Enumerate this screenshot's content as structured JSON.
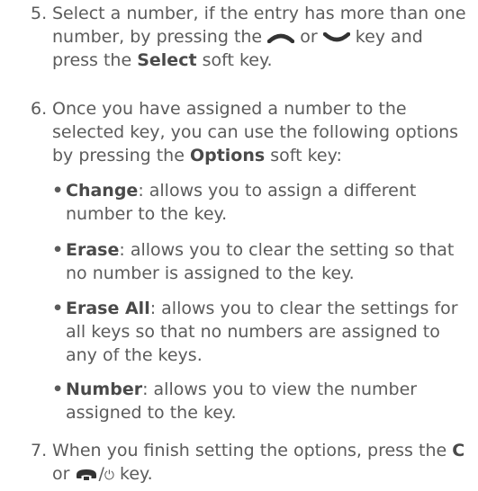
{
  "step5": {
    "number": "5.",
    "text_a": "Select a number, if the entry has more than one number, by pressing the",
    "text_or": "or",
    "text_b": "key and press the",
    "bold_select": "Select",
    "text_c": "soft key.",
    "up_icon": "up-key-icon",
    "down_icon": "down-key-icon"
  },
  "step6": {
    "number": "6.",
    "text_a": "Once you have assigned a number to the selected key, you can use the following options by pressing the",
    "bold_options": "Options",
    "text_b": "soft key:",
    "bullets": [
      {
        "bullet": "•",
        "term": "Change",
        "desc": ": allows you to assign a different number to the key."
      },
      {
        "bullet": "•",
        "term": "Erase",
        "desc": ": allows you to clear the setting so that no number is assigned to the key."
      },
      {
        "bullet": "•",
        "term": "Erase All",
        "desc": ": allows you to clear the settings for all keys so that no numbers are assigned to any of the keys."
      },
      {
        "bullet": "•",
        "term": "Number",
        "desc": ": allows you to view the number assigned to the key."
      }
    ]
  },
  "step7": {
    "number": "7.",
    "text_a": "When you finish setting the options, press the",
    "bold_c": "C",
    "text_or": "or",
    "power_slash": "/",
    "power_symbol": "⏻",
    "text_b": "key.",
    "end_icon": "end-call-key-icon"
  },
  "colors": {
    "text": "#5b5b5b",
    "icon": "#333333"
  }
}
